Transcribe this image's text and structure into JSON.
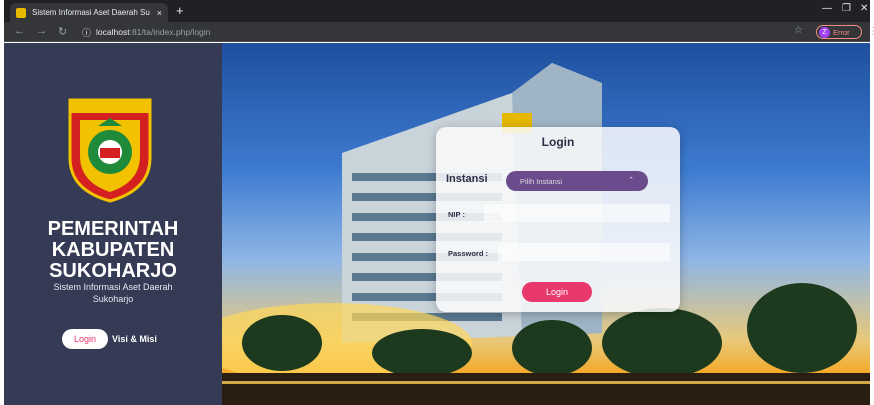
{
  "browser": {
    "tab_title": "Sistem Informasi Aset Daerah Su",
    "tab_close": "×",
    "new_tab": "+",
    "url_host": "localhost",
    "url_path": ":81/ta/index.php/login",
    "profile_initial": "Z",
    "profile_label": "Error"
  },
  "sidebar": {
    "emblem_text": "KABUPATEN SUKOHARJO",
    "government_title": "PEMERINTAH KABUPATEN SUKOHARJO",
    "subtitle": "Sistem Informasi Aset Daerah Sukoharjo",
    "login_label": "Login",
    "visi_label": "Visi & Misi"
  },
  "login_card": {
    "title": "Login",
    "instansi_label": "Instansi",
    "instansi_placeholder": "Pilih Instansi",
    "nip_label": "NIP :",
    "password_label": "Password :",
    "submit_label": "Login"
  },
  "colors": {
    "sidebar_bg": "#353a55",
    "accent_pink": "#e8386c",
    "select_purple": "#6a4c8c"
  }
}
